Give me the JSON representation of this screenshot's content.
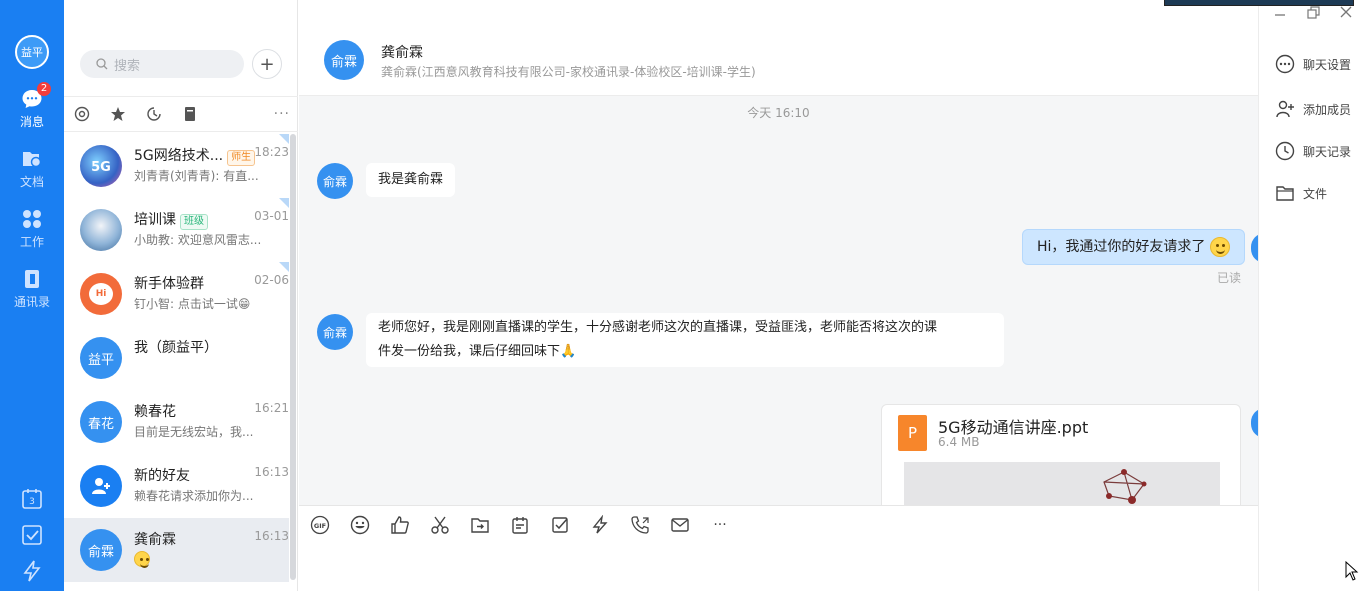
{
  "nav": {
    "user_avatar": "益平",
    "items": [
      {
        "label": "消息",
        "icon": "message-icon",
        "badge": "2"
      },
      {
        "label": "文档",
        "icon": "document-icon"
      },
      {
        "label": "工作",
        "icon": "work-icon"
      },
      {
        "label": "通讯录",
        "icon": "contacts-icon"
      }
    ],
    "calendar_day": "3"
  },
  "list": {
    "search_placeholder": "搜索",
    "add_label": "+",
    "more": "···",
    "conversations": [
      {
        "name": "5G网络技术...",
        "tag": "师生",
        "time": "18:23",
        "preview": "刘青青(刘青青): 有直..."
      },
      {
        "name": "培训课",
        "tag": "班级",
        "time": "03-01",
        "preview": "小助教: 欢迎意风雷志..."
      },
      {
        "name": "新手体验群",
        "time": "02-06",
        "preview": "钉小智: 点击试一试😁",
        "avatar": "Hi"
      },
      {
        "name": "我（颜益平）",
        "avatar": "益平"
      },
      {
        "name": "赖春花",
        "time": "16:21",
        "preview": "目前是无线宏站，我...",
        "avatar": "春花"
      },
      {
        "name": "新的好友",
        "time": "16:13",
        "preview": "赖春花请求添加你为..."
      },
      {
        "name": "龚俞霖",
        "time": "16:13",
        "avatar": "俞霖"
      }
    ]
  },
  "chat": {
    "avatar": "俞霖",
    "name": "龚俞霖",
    "subtitle": "龚俞霖(江西意风教育科技有限公司-家校通讯录-体验校区-培训课-学生)",
    "time_divider": "今天 16:10",
    "messages": [
      {
        "text": "我是龚俞霖"
      },
      {
        "text": "Hi，我通过你的好友请求了",
        "status": "已读"
      },
      {
        "line1": "老师您好，我是刚刚直播课的学生，十分感谢老师这次的直播课，受益匪浅，老师能否将这次的课",
        "line2": "件发一份给我，课后仔细回味下🙏"
      }
    ],
    "file": {
      "icon": "P",
      "name": "5G移动通信讲座.ppt",
      "size": "6.4 MB"
    },
    "toolbar": [
      "gif-icon",
      "emoji-icon",
      "thumbs-up-icon",
      "scissors-icon",
      "folder-send-icon",
      "calendar-icon",
      "task-check-icon",
      "ding-icon",
      "phone-icon",
      "mail-icon",
      "more-icon"
    ],
    "more_label": "···"
  },
  "side": {
    "items": [
      {
        "label": "聊天设置",
        "icon": "chat-settings-icon"
      },
      {
        "label": "添加成员",
        "icon": "add-member-icon"
      },
      {
        "label": "聊天记录",
        "icon": "history-icon"
      },
      {
        "label": "文件",
        "icon": "folder-icon"
      }
    ]
  },
  "colors": {
    "nav": "#1a7ff2",
    "avatar": "#3591f0",
    "my_bubble": "#cde6ff",
    "badge": "#f23d3d"
  }
}
